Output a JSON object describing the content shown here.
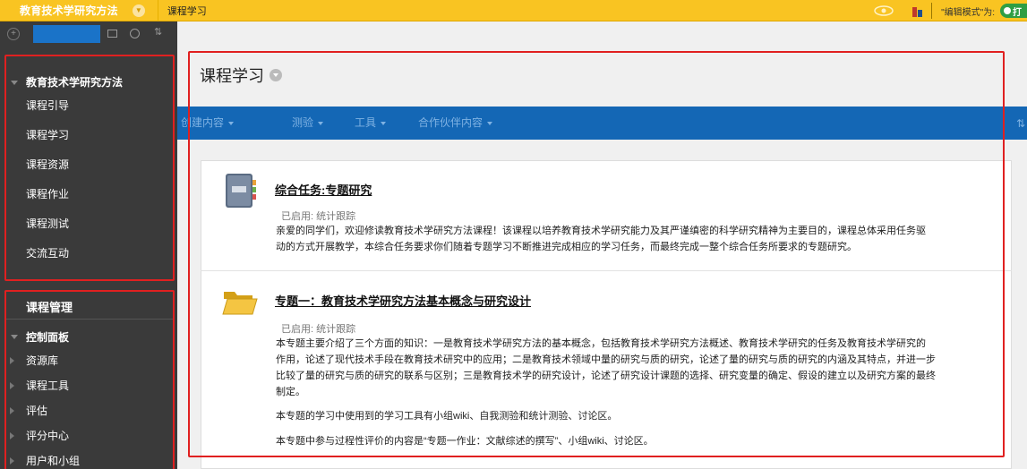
{
  "topbar": {
    "course_name": "教育技术学研究方法",
    "breadcrumb": "课程学习",
    "edit_mode_label": "\"编辑模式\"为:",
    "edit_mode_value": "打"
  },
  "sidebar": {
    "course_tree_title": "教育技术学研究方法",
    "course_items": [
      "课程引导",
      "课程学习",
      "课程资源",
      "课程作业",
      "课程测试",
      "交流互动"
    ],
    "management_title": "课程管理",
    "control_panel_title": "控制面板",
    "control_items": [
      "资源库",
      "课程工具",
      "评估",
      "评分中心",
      "用户和小组"
    ]
  },
  "main": {
    "page_title": "课程学习",
    "actions": [
      "创建内容",
      "测验",
      "工具",
      "合作伙伴内容"
    ],
    "items": [
      {
        "title": "综合任务:专题研究",
        "status": "已启用:  统计跟踪",
        "lines": [
          "亲爱的同学们，欢迎修读教育技术学研究方法课程！该课程以培养教育技术学研究能力及其严谨缜密的科学研究精神为主要目的，课程总体采用任务驱",
          "动的方式开展教学，本综合任务要求你们随着专题学习不断推进完成相应的学习任务，而最终完成一整个综合任务所要求的专题研究。"
        ]
      },
      {
        "title": "专题一：教育技术学研究方法基本概念与研究设计",
        "status": "已启用:  统计跟踪",
        "lines": [
          "本专题主要介绍了三个方面的知识：一是教育技术学研究方法的基本概念，包括教育技术学研究方法概述、教育技术学研究的任务及教育技术学研究的",
          "作用，论述了现代技术手段在教育技术研究中的应用；二是教育技术领域中量的研究与质的研究，论述了量的研究与质的研究的内涵及其特点，并进一步",
          "比较了量的研究与质的研究的联系与区别；三是教育技术学的研究设计，论述了研究设计课题的选择、研究变量的确定、假设的建立以及研究方案的最终",
          "制定。"
        ],
        "tools_note": "本专题的学习中使用到的学习工具有小组wiki、自我测验和统计测验、讨论区。",
        "eval_note": "本专题中参与过程性评价的内容是“专题一作业：文献综述的撰写”、小组wiki、讨论区。"
      }
    ]
  },
  "colors": {
    "topbar": "#f9c422",
    "sidebar": "#3a3a3a",
    "action_bar": "#1467b5",
    "highlight": "#e02020",
    "toggle_on": "#2f9e44"
  }
}
